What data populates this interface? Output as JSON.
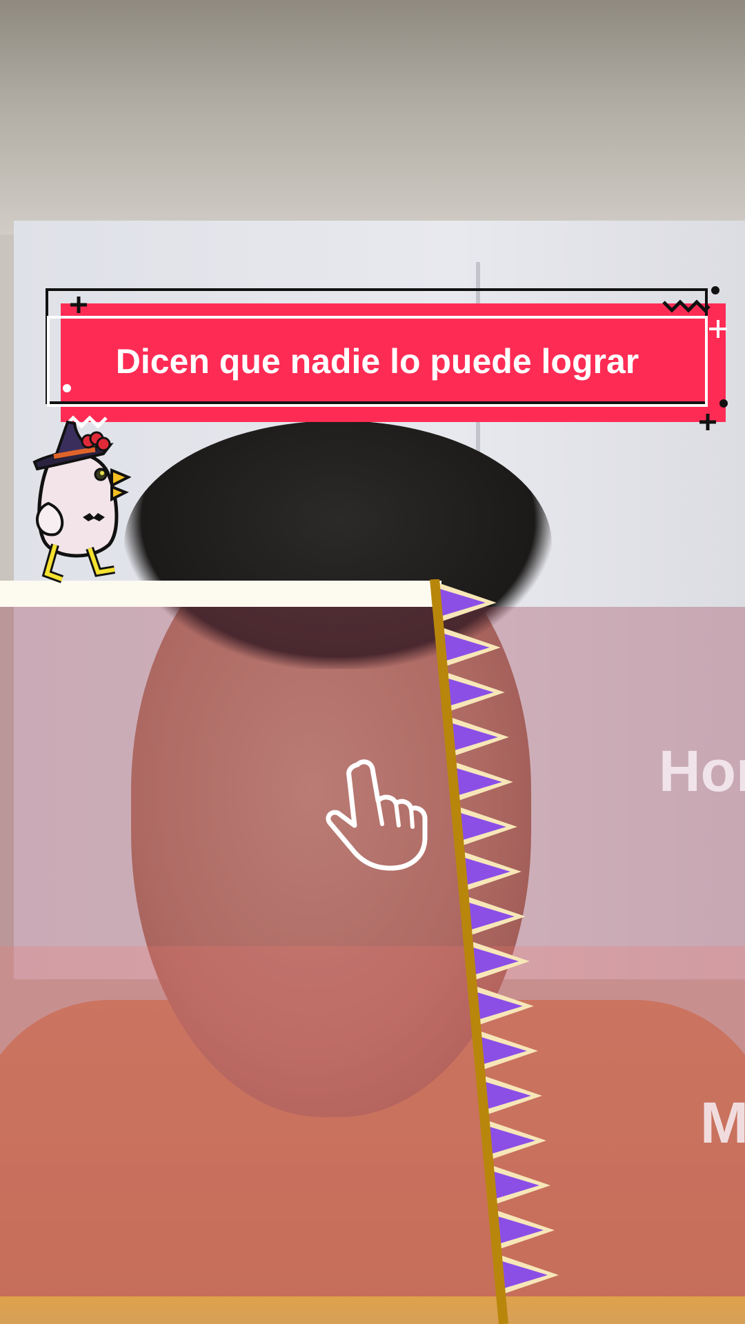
{
  "caption": {
    "text": "Dicen que nadie lo puede lograr"
  },
  "overlay_words": [
    "Hor",
    "M"
  ],
  "colors": {
    "caption_bg": "#fe2c55",
    "caption_text": "#ffffff",
    "flag_fill": "#8b4fe6",
    "flag_pole": "#b8860b"
  },
  "stickers": {
    "chicken": "witch-hat-chicken-sticker",
    "hand": "pointing-hand-icon"
  }
}
